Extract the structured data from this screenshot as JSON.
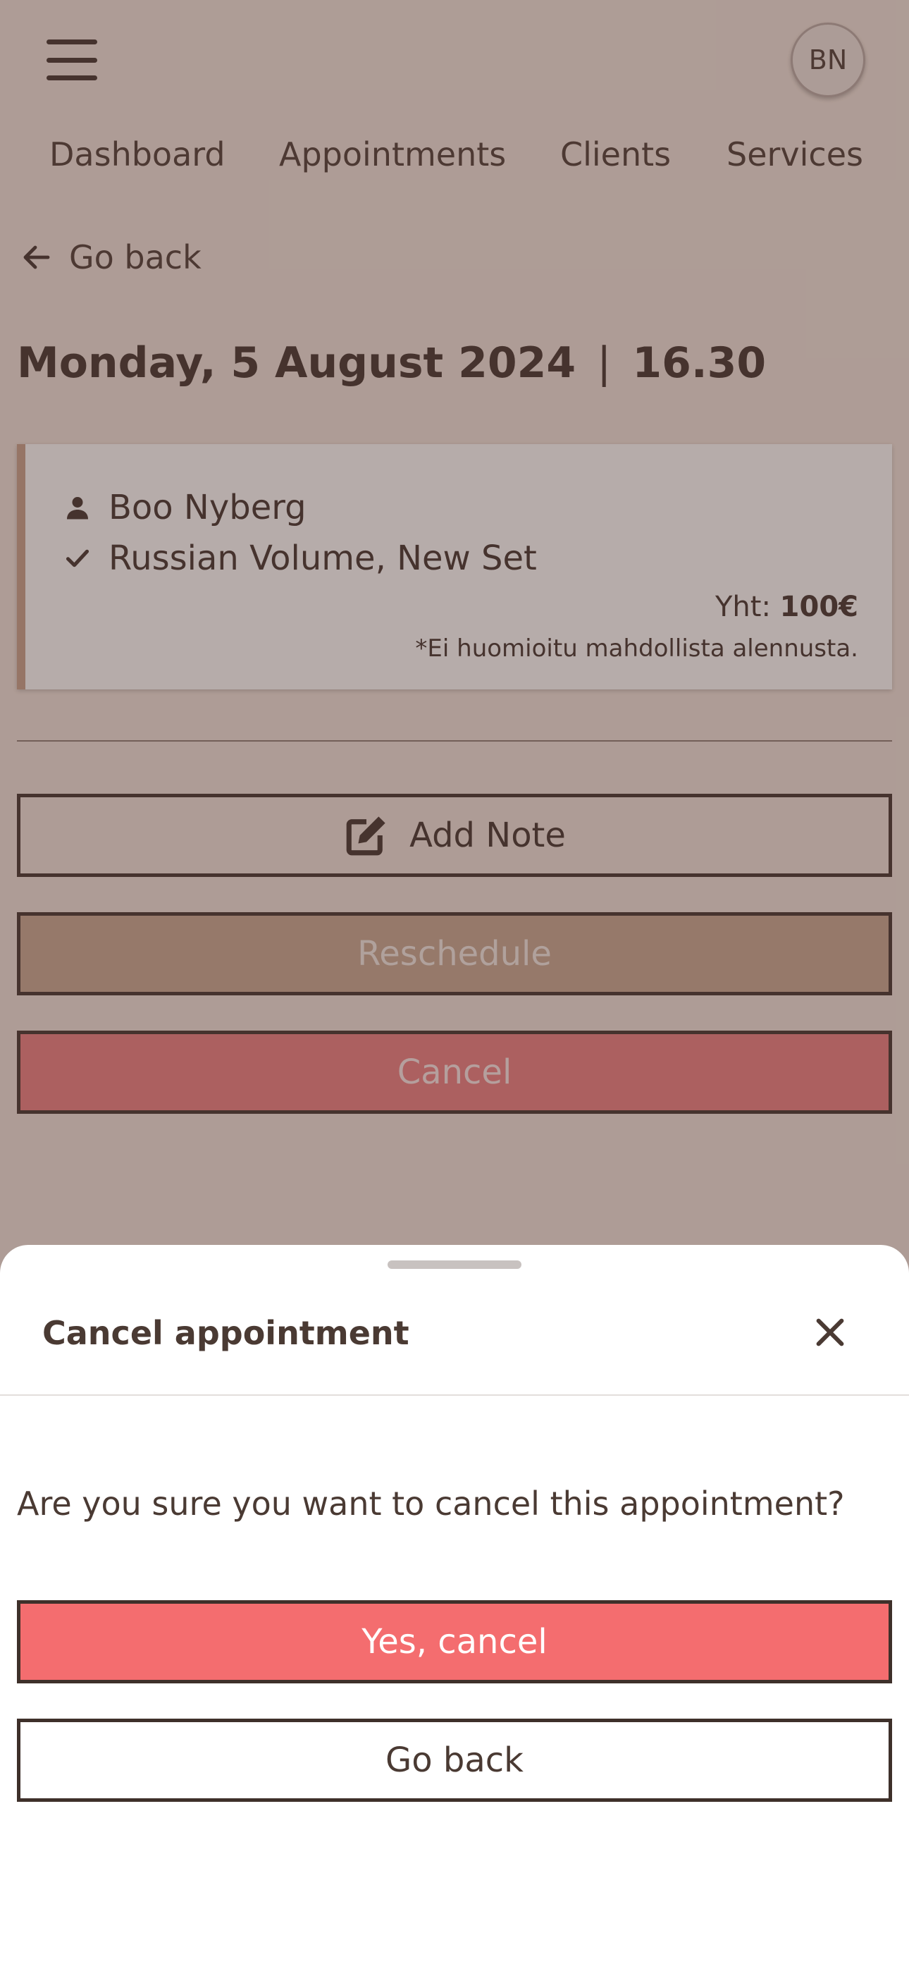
{
  "header": {
    "avatar_initials": "BN"
  },
  "nav": {
    "items": [
      "Dashboard",
      "Appointments",
      "Clients",
      "Services"
    ]
  },
  "back_link": "Go back",
  "appointment": {
    "date": "Monday, 5 August 2024",
    "separator": "|",
    "time": "16.30",
    "client_name": "Boo Nyberg",
    "service": "Russian Volume, New Set",
    "total_label": "Yht:",
    "total_value": "100€",
    "discount_note": "*Ei huomioitu mahdollista alennusta."
  },
  "actions": {
    "add_note": "Add Note",
    "reschedule": "Reschedule",
    "cancel": "Cancel"
  },
  "sheet": {
    "title": "Cancel appointment",
    "message": "Are you sure you want to cancel this appointment?",
    "confirm": "Yes, cancel",
    "go_back": "Go back"
  },
  "colors": {
    "accent": "#c9a08a",
    "danger": "#f46d6f",
    "text": "#4a3a33"
  }
}
